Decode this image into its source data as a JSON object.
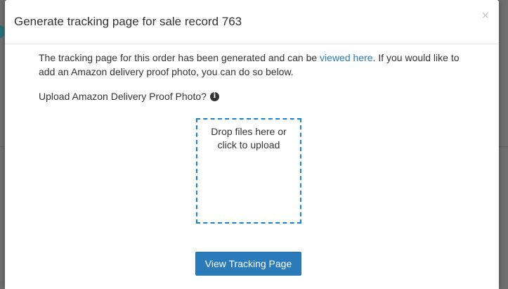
{
  "modal": {
    "title": "Generate tracking page for sale record 763",
    "close_symbol": "×",
    "intro_before_link": "The tracking page for this order has been generated and can be ",
    "intro_link": "viewed here",
    "intro_after_link": ". If you would like to add an Amazon delivery proof photo, you can do so below.",
    "upload_label": "Upload Amazon Delivery Proof Photo?",
    "info_icon_glyph": "i",
    "dropzone_text": "Drop files here or click to upload",
    "primary_button": "View Tracking Page"
  },
  "colors": {
    "link": "#2a7ab0",
    "dropzone_border": "#1a82d4",
    "button_bg": "#2b7bbb"
  },
  "icons": {
    "close": "close-icon",
    "info": "info-circle-icon"
  }
}
